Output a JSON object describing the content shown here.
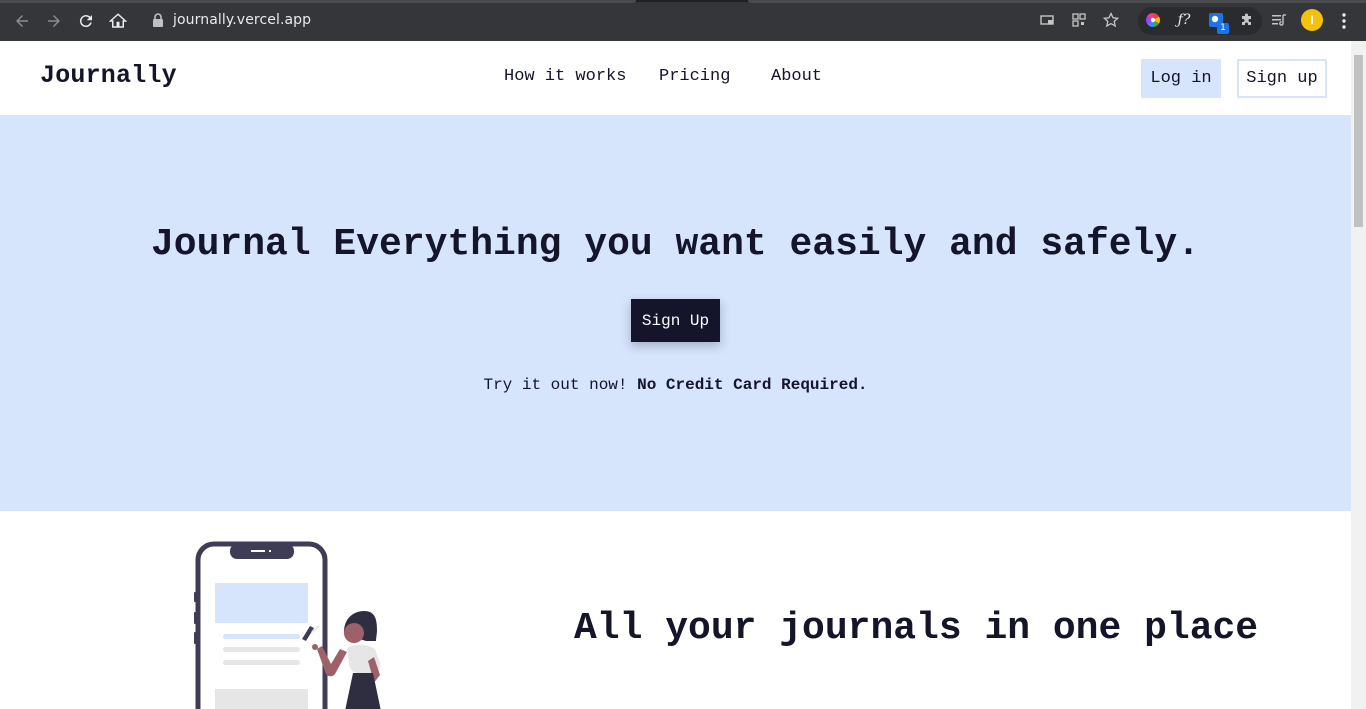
{
  "browser": {
    "url": "journally.vercel.app",
    "extension_badge": "1",
    "profile_initial": "I",
    "icons": [
      "back-icon",
      "forward-icon",
      "reload-icon",
      "home-icon",
      "lock-icon",
      "cast-icon",
      "qr-icon",
      "star-icon",
      "color-wheel-icon",
      "font-icon",
      "extension-icon",
      "puzzle-icon",
      "reading-list-icon",
      "kebab-menu-icon"
    ]
  },
  "site": {
    "brand": "Journally",
    "nav": [
      {
        "label": "How it works"
      },
      {
        "label": "Pricing"
      },
      {
        "label": "About"
      }
    ],
    "login_label": "Log in",
    "signup_label": "Sign up"
  },
  "hero": {
    "title": "Journal Everything you want easily and safely.",
    "cta_label": "Sign Up",
    "note_prefix": "Try it out now! ",
    "note_emphasis": "No Credit Card Required."
  },
  "feature": {
    "title": "All your journals in one place"
  },
  "colors": {
    "hero_bg": "#d6e4fc",
    "ink": "#14142b",
    "chrome_bg": "#35363a",
    "illustration_accent": "#9e616a",
    "illustration_frame": "#3f3d56"
  }
}
